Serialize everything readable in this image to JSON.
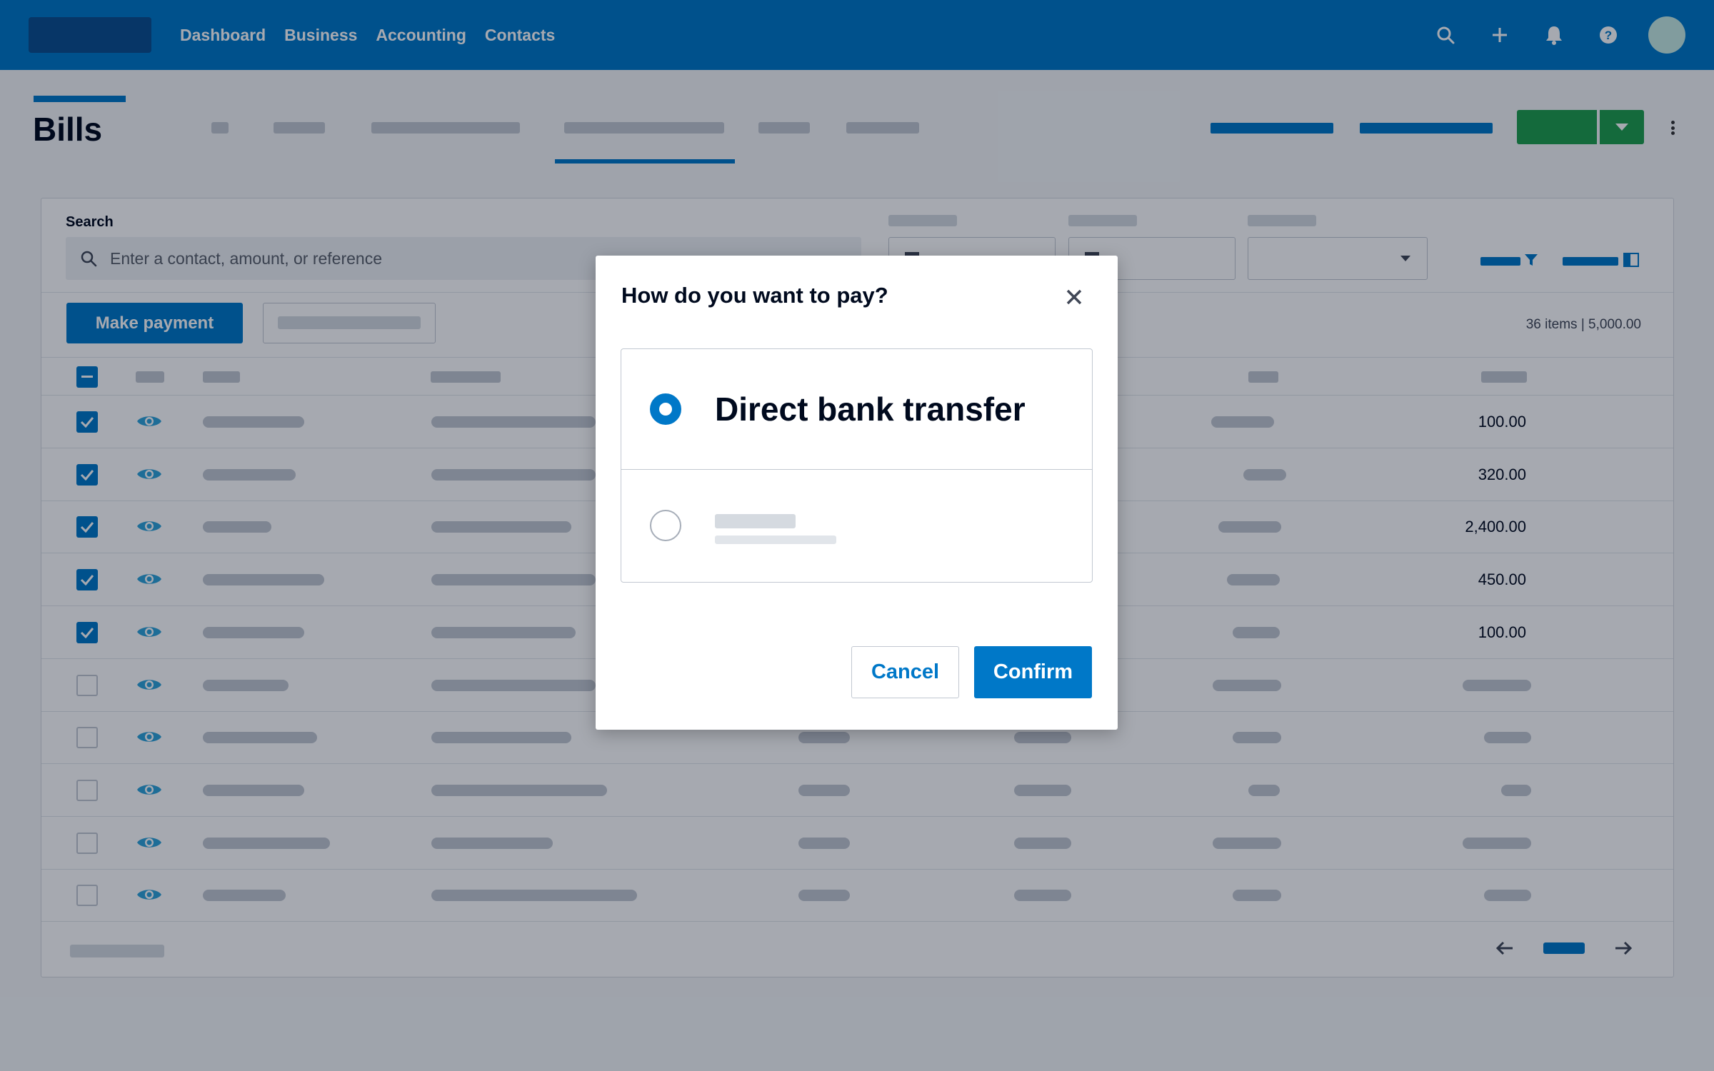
{
  "nav": {
    "items": [
      "Dashboard",
      "Business",
      "Accounting",
      "Contacts"
    ],
    "icons": [
      "search-icon",
      "plus-icon",
      "bell-icon",
      "help-icon"
    ]
  },
  "page": {
    "title": "Bills"
  },
  "search": {
    "label": "Search",
    "placeholder": "Enter a contact, amount, or reference"
  },
  "toolbar": {
    "make_payment_label": "Make payment",
    "summary": "36 items | 5,000.00"
  },
  "table": {
    "rows": [
      {
        "checked": true,
        "amount": "100.00"
      },
      {
        "checked": true,
        "amount": "320.00"
      },
      {
        "checked": true,
        "amount": "2,400.00"
      },
      {
        "checked": true,
        "amount": "450.00"
      },
      {
        "checked": true,
        "amount": "100.00"
      },
      {
        "checked": false,
        "amount": ""
      },
      {
        "checked": false,
        "amount": ""
      },
      {
        "checked": false,
        "amount": ""
      },
      {
        "checked": false,
        "amount": ""
      },
      {
        "checked": false,
        "amount": ""
      }
    ]
  },
  "modal": {
    "title": "How do you want to pay?",
    "options": [
      {
        "label": "Direct bank transfer",
        "selected": true
      },
      {
        "label": "",
        "selected": false
      }
    ],
    "cancel_label": "Cancel",
    "confirm_label": "Confirm"
  },
  "colors": {
    "brand_blue": "#0078c8",
    "nav_blue": "#0078c8",
    "success_green": "#1f9f4e",
    "overlay": "rgba(0,10,30,0.35)"
  }
}
